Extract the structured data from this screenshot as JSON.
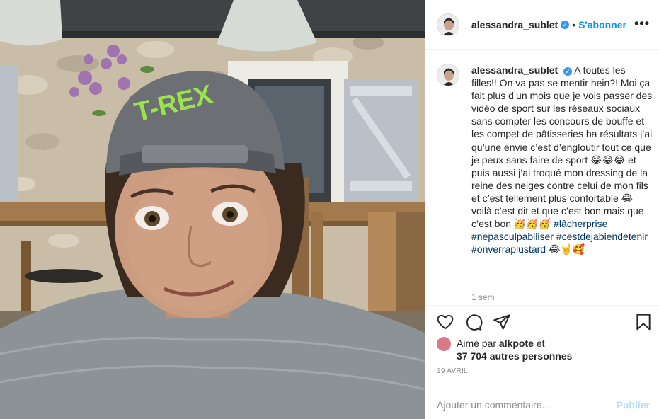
{
  "header": {
    "username": "alessandra_sublet",
    "verified_mark": "✓",
    "separator": "•",
    "follow_label": "S'abonner",
    "more_label": "•••"
  },
  "caption": {
    "username": "alessandra_sublet",
    "verified_mark": "✓",
    "text_1": "A toutes les filles!! On va pas se mentir hein?! Moi ça fait plus d’un mois que je vois passer des vidéo de sport sur les réseaux sociaux sans compter les concours de bouffe et les compet de pâtisseries ba résultats j’ai qu’une envie c’est d’engloutir tout ce que je peux sans faire de sport 😂😂😂 et puis aussi j’ai troqué mon dressing de la reine des neiges contre celui de mon fils et c’est tellement plus confortable 😂 voilà c’est dit et que c’est bon mais que c’est bon 🥳🥳🥳 ",
    "hashtags": [
      "#lâcherprise",
      "#nepasculpabiliser",
      "#cestdejabiendetenir",
      "#onverraplustard"
    ],
    "text_end": "😂🤘🥰",
    "time_ago": "1 sem"
  },
  "actions": {
    "like_icon": "heart-icon",
    "comment_icon": "comment-icon",
    "share_icon": "send-icon",
    "save_icon": "bookmark-icon"
  },
  "likes": {
    "prefix": "Aimé par ",
    "user": "alkpote",
    "suffix": " et",
    "others": "37 704 autres personnes"
  },
  "date": "19 AVRIL",
  "comment": {
    "placeholder": "Ajouter un commentaire...",
    "publish_label": "Publier"
  },
  "colors": {
    "accent": "#0095f6",
    "publish_disabled": "#b2dffc",
    "hashtag": "#00376b",
    "muted": "#8e8e8e"
  }
}
